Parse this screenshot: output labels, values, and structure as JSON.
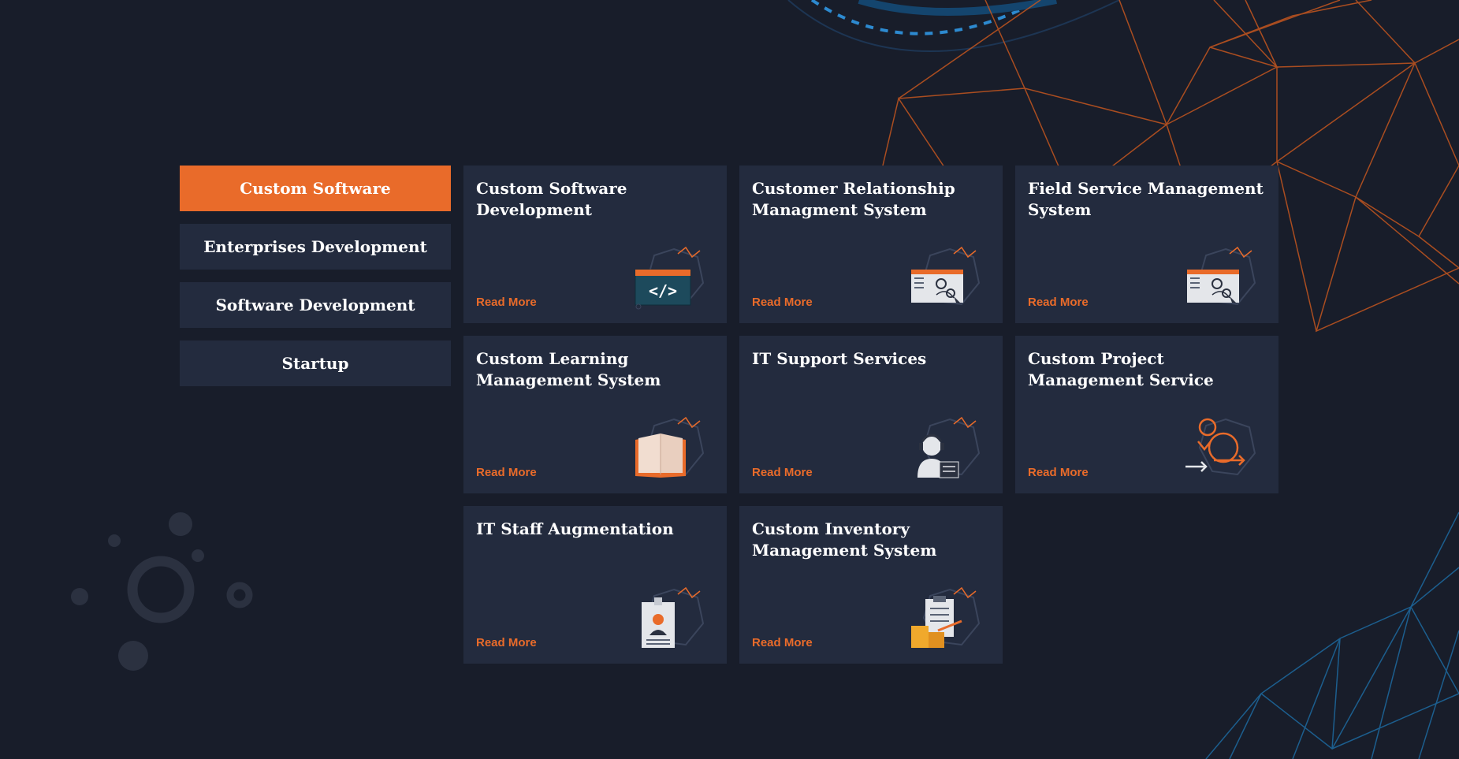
{
  "sidebar": {
    "tabs": [
      {
        "label": "Custom Software",
        "active": true
      },
      {
        "label": "Enterprises Development",
        "active": false
      },
      {
        "label": "Software Development",
        "active": false
      },
      {
        "label": "Startup",
        "active": false
      }
    ]
  },
  "cards": [
    {
      "title": "Custom Software Development",
      "link": "Read More",
      "icon": "code-window-icon"
    },
    {
      "title": "Customer Relationship Managment System",
      "link": "Read More",
      "icon": "map-pin-window-icon"
    },
    {
      "title": "Field Service Management System",
      "link": "Read More",
      "icon": "map-pin-window-icon"
    },
    {
      "title": "Custom Learning Management System",
      "link": "Read More",
      "icon": "open-book-icon"
    },
    {
      "title": "IT Support Services",
      "link": "Read More",
      "icon": "support-agent-icon"
    },
    {
      "title": "Custom Project Management Service",
      "link": "Read More",
      "icon": "cycle-arrows-icon"
    },
    {
      "title": "IT Staff Augmentation",
      "link": "Read More",
      "icon": "id-badge-icon"
    },
    {
      "title": "Custom Inventory Management System",
      "link": "Read More",
      "icon": "clipboard-boxes-icon"
    }
  ],
  "colors": {
    "background": "#181d2a",
    "card": "#232b3e",
    "accent": "#e96b2a",
    "text": "#ffffff",
    "mesh_orange": "#c4561f",
    "mesh_blue": "#1d6fa8"
  }
}
